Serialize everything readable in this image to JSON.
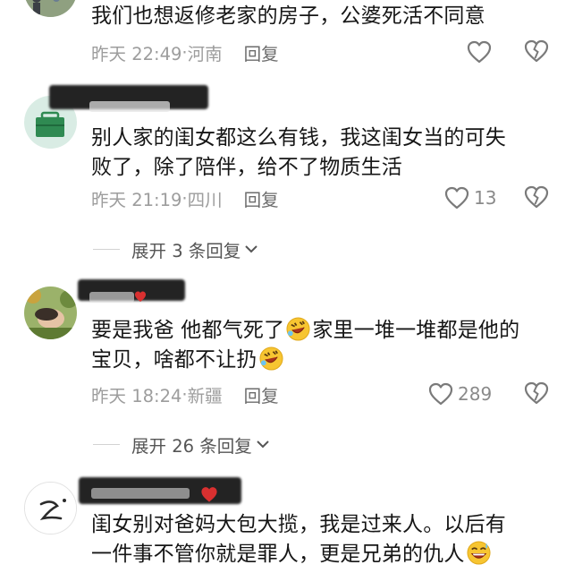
{
  "comments": [
    {
      "text_lines": [
        "我们也想返修老家的房子，公婆死活不同意"
      ],
      "time": "昨天 22:49",
      "location": "河南",
      "reply_label": "回复",
      "like_count": ""
    },
    {
      "text_lines": [
        "别人家的闺女都这么有钱，我这闺女当的可失",
        "败了，除了陪伴，给不了物质生活"
      ],
      "time": "昨天 21:19",
      "location": "四川",
      "reply_label": "回复",
      "like_count": "13"
    },
    {
      "text_line1_a": "要是我爸 他都气死了",
      "text_line1_b": "家里一堆一堆都是他的",
      "text_line2": "宝贝，啥都不让扔",
      "time": "昨天 18:24",
      "location": "新疆",
      "reply_label": "回复",
      "like_count": "289"
    },
    {
      "text_line1": "闺女别对爸妈大包大揽，我是过来人。以后有",
      "text_line2": "一件事不管你就是罪人，更是兄弟的仇人"
    }
  ],
  "expand": [
    {
      "label": "展开 3 条回复"
    },
    {
      "label": "展开 26 条回复"
    }
  ],
  "icons": {
    "like": "heart-outline-icon",
    "dislike": "broken-heart-icon",
    "expand": "chevron-down-icon",
    "emoji_laugh": "rolling-laughing-emoji-icon",
    "emoji_sweat": "grinning-sweat-emoji-icon"
  },
  "colors": {
    "meta": "#9d9d9d",
    "text": "#161616",
    "icon": "#7a7a7a"
  }
}
